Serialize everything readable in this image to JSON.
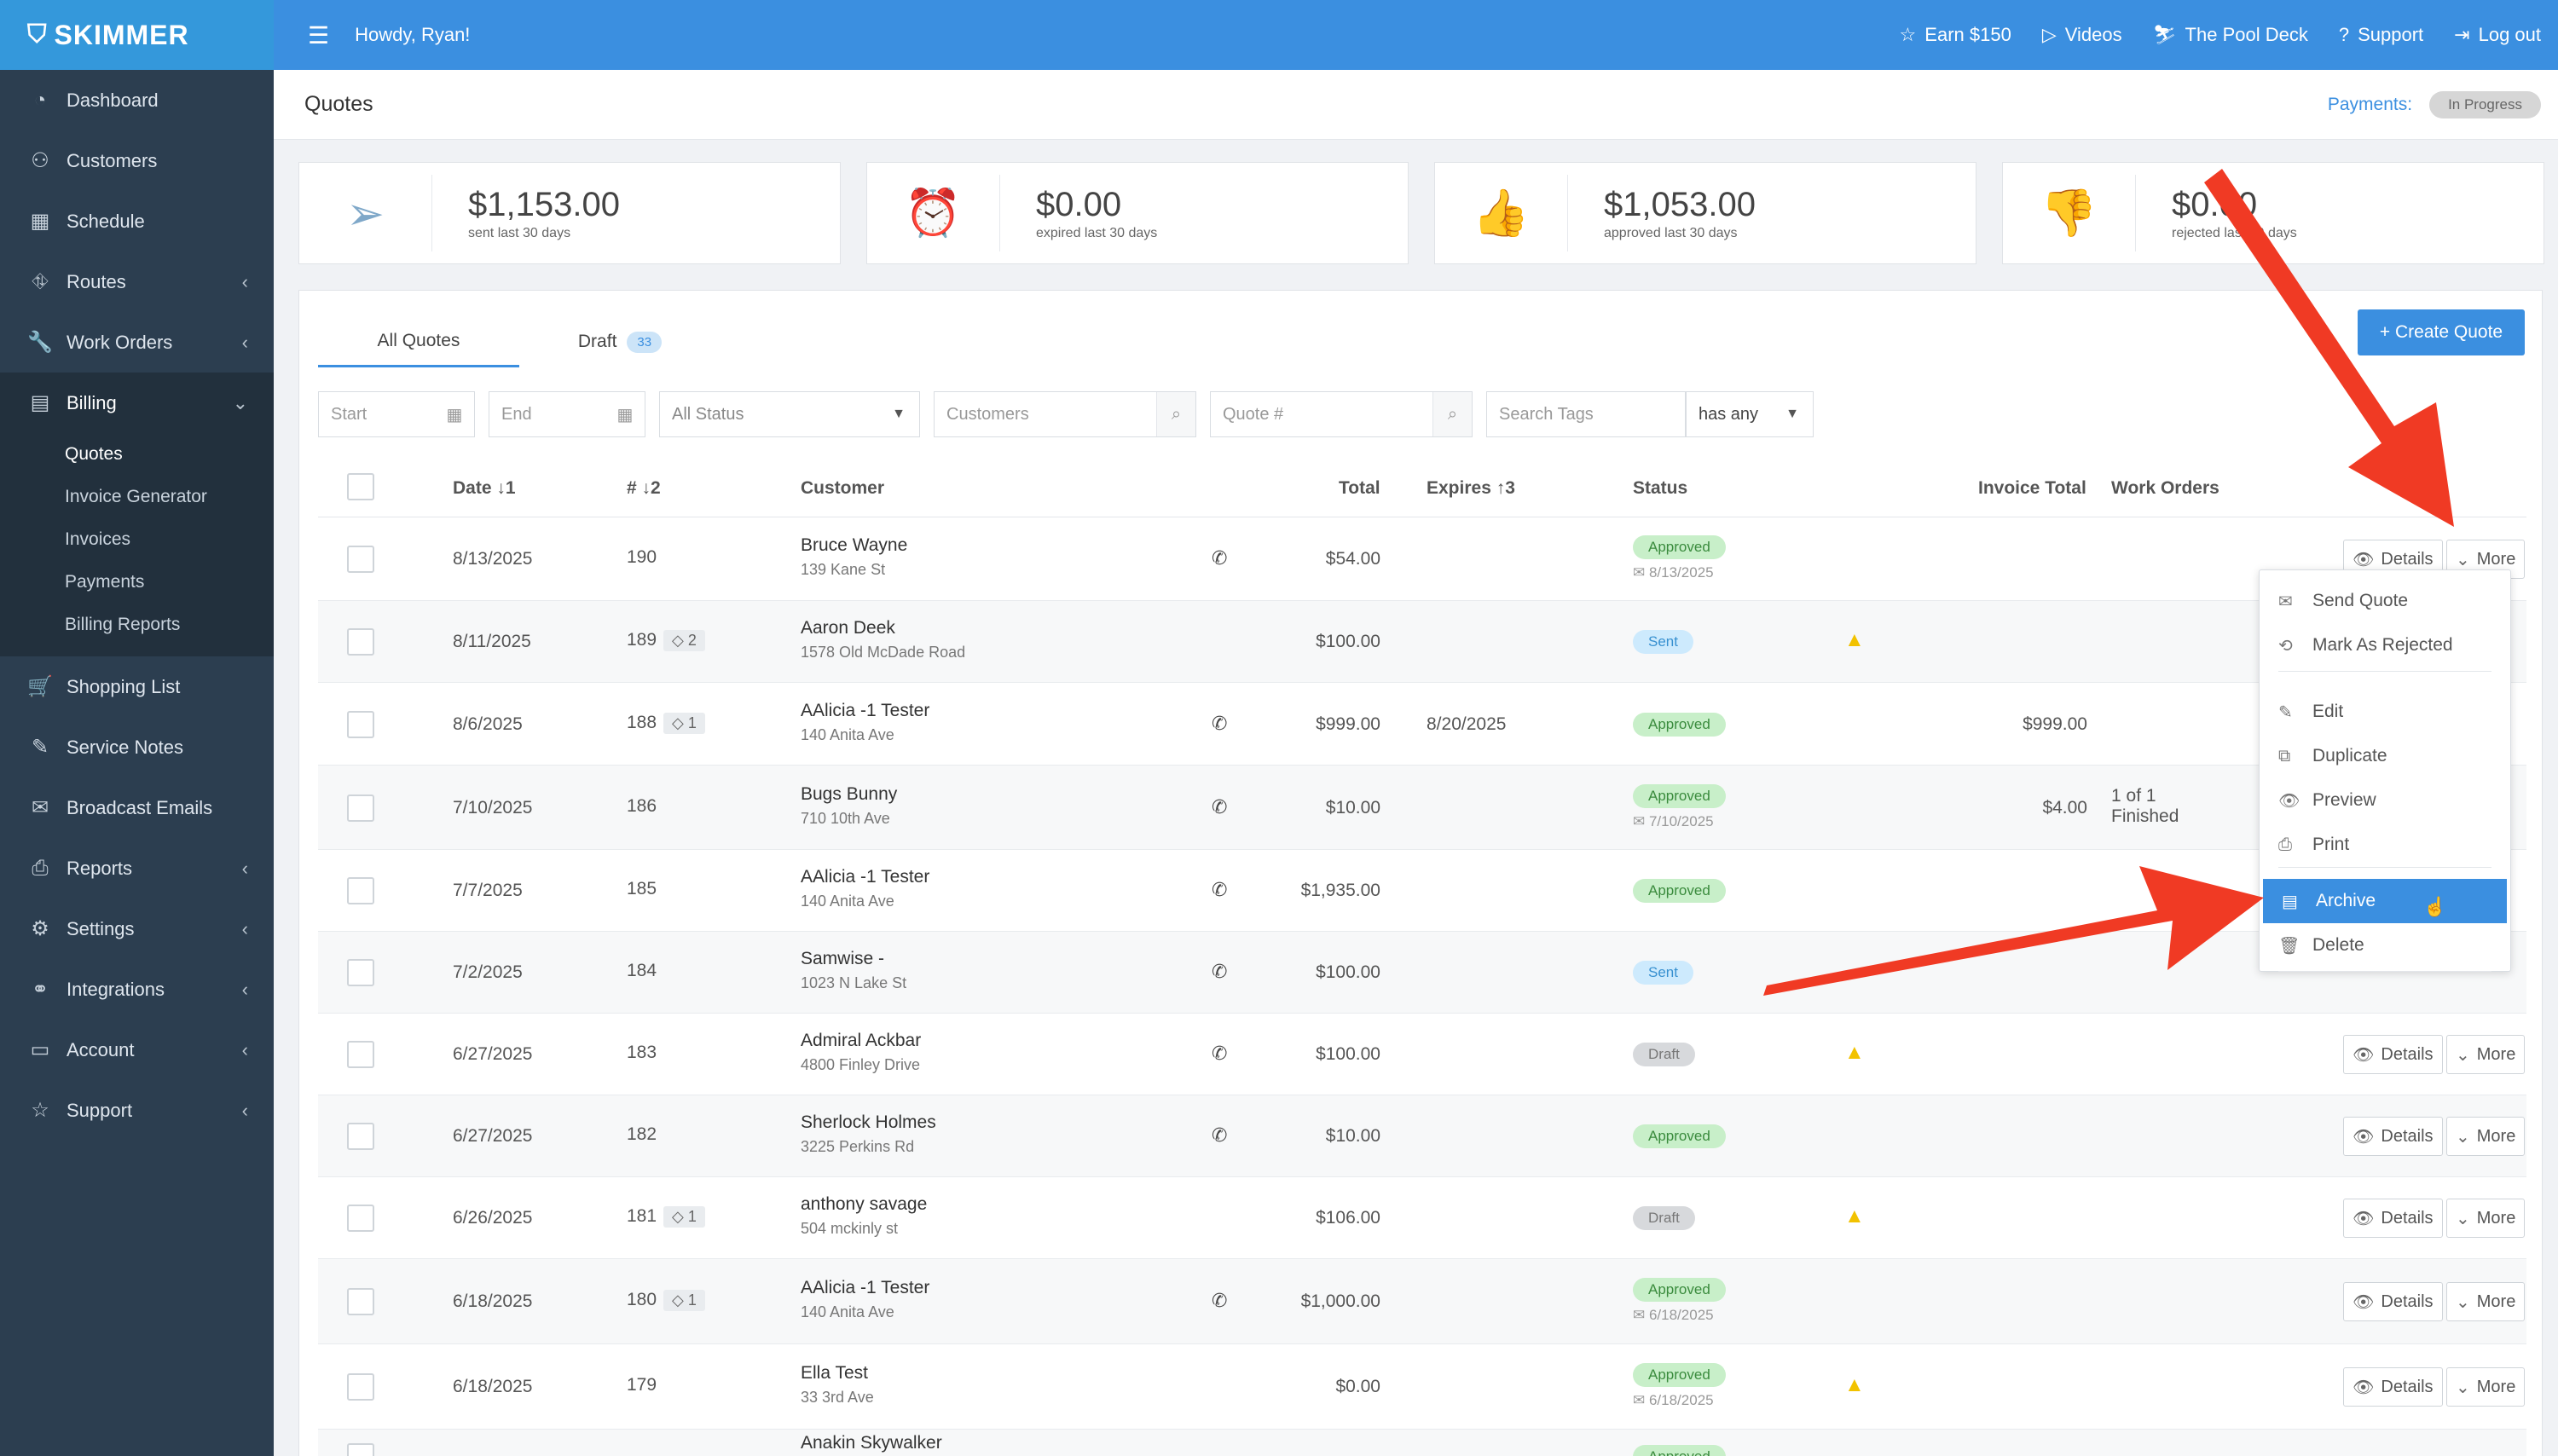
{
  "app": {
    "logo": "SKIMMER"
  },
  "sidebar": {
    "items": [
      {
        "label": "Dashboard",
        "icon": "dashboard-icon"
      },
      {
        "label": "Customers",
        "icon": "customers-icon"
      },
      {
        "label": "Schedule",
        "icon": "calendar-icon"
      },
      {
        "label": "Routes",
        "icon": "routes-icon"
      },
      {
        "label": "Work Orders",
        "icon": "wrench-icon"
      },
      {
        "label": "Billing",
        "icon": "billing-icon"
      }
    ],
    "billing_sub": [
      "Quotes",
      "Invoice Generator",
      "Invoices",
      "Payments",
      "Billing Reports"
    ],
    "items2": [
      {
        "label": "Shopping List",
        "icon": "cart-icon"
      },
      {
        "label": "Service Notes",
        "icon": "note-icon"
      },
      {
        "label": "Broadcast Emails",
        "icon": "mail-icon"
      },
      {
        "label": "Reports",
        "icon": "printer-icon"
      },
      {
        "label": "Settings",
        "icon": "gear-icon"
      },
      {
        "label": "Integrations",
        "icon": "link-icon"
      },
      {
        "label": "Account",
        "icon": "card-icon"
      },
      {
        "label": "Support",
        "icon": "star-icon"
      }
    ]
  },
  "topbar": {
    "greeting": "Howdy, Ryan!",
    "links": [
      "Earn $150",
      "Videos",
      "The Pool Deck",
      "Support",
      "Log out"
    ]
  },
  "header": {
    "title": "Quotes",
    "payments_label": "Payments:",
    "payments_badge": "In Progress"
  },
  "stats": [
    {
      "amount": "$1,153.00",
      "label": "sent last 30 days",
      "icon": "paper-plane-icon",
      "color": "#7fa8c9"
    },
    {
      "amount": "$0.00",
      "label": "expired last 30 days",
      "icon": "alarm-clock-icon",
      "color": "#e58a84"
    },
    {
      "amount": "$1,053.00",
      "label": "approved last 30 days",
      "icon": "thumbs-up-icon",
      "color": "#7dc47f"
    },
    {
      "amount": "$0.00",
      "label": "rejected last 30 days",
      "icon": "thumbs-down-icon",
      "color": "#e58a84"
    }
  ],
  "tabs": {
    "all": "All Quotes",
    "draft": "Draft",
    "draft_count": "33"
  },
  "create_button": "+ Create Quote",
  "filters": {
    "start": "Start",
    "end": "End",
    "status": "All Status",
    "customers": "Customers",
    "quote": "Quote #",
    "tags": "Search Tags",
    "tag_mode": "has any"
  },
  "columns": {
    "date": "Date ↓1",
    "num": "# ↓2",
    "customer": "Customer",
    "total": "Total",
    "expires": "Expires ↑3",
    "status": "Status",
    "invoice_total": "Invoice Total",
    "work_orders": "Work Orders"
  },
  "rows": [
    {
      "date": "8/13/2025",
      "num": "190",
      "tag": "",
      "name": "Bruce Wayne",
      "addr": "139 Kane St",
      "phone": true,
      "total": "$54.00",
      "expires": "",
      "status": "Approved",
      "status_date": "8/13/2025",
      "warn": false,
      "invoice": "",
      "wo1": "",
      "wo2": ""
    },
    {
      "date": "8/11/2025",
      "num": "189",
      "tag": "2",
      "name": "Aaron Deek",
      "addr": "1578 Old McDade Road",
      "phone": false,
      "total": "$100.00",
      "expires": "",
      "status": "Sent",
      "status_date": "",
      "warn": true,
      "invoice": "",
      "wo1": "",
      "wo2": ""
    },
    {
      "date": "8/6/2025",
      "num": "188",
      "tag": "1",
      "name": "AAlicia -1 Tester",
      "addr": "140 Anita Ave",
      "phone": true,
      "total": "$999.00",
      "expires": "8/20/2025",
      "status": "Approved",
      "status_date": "",
      "warn": false,
      "invoice": "$999.00",
      "wo1": "",
      "wo2": ""
    },
    {
      "date": "7/10/2025",
      "num": "186",
      "tag": "",
      "name": "Bugs Bunny",
      "addr": "710 10th Ave",
      "phone": true,
      "total": "$10.00",
      "expires": "",
      "status": "Approved",
      "status_date": "7/10/2025",
      "warn": false,
      "invoice": "$4.00",
      "wo1": "1 of 1",
      "wo2": "Finished"
    },
    {
      "date": "7/7/2025",
      "num": "185",
      "tag": "",
      "name": "AAlicia -1 Tester",
      "addr": "140 Anita Ave",
      "phone": true,
      "total": "$1,935.00",
      "expires": "",
      "status": "Approved",
      "status_date": "",
      "warn": false,
      "invoice": "",
      "wo1": "",
      "wo2": ""
    },
    {
      "date": "7/2/2025",
      "num": "184",
      "tag": "",
      "name": "Samwise -",
      "addr": "1023 N Lake St",
      "phone": true,
      "total": "$100.00",
      "expires": "",
      "status": "Sent",
      "status_date": "",
      "warn": false,
      "invoice": "",
      "wo1": "",
      "wo2": ""
    },
    {
      "date": "6/27/2025",
      "num": "183",
      "tag": "",
      "name": "Admiral Ackbar",
      "addr": "4800 Finley Drive",
      "phone": true,
      "total": "$100.00",
      "expires": "",
      "status": "Draft",
      "status_date": "",
      "warn": true,
      "invoice": "",
      "wo1": "",
      "wo2": ""
    },
    {
      "date": "6/27/2025",
      "num": "182",
      "tag": "",
      "name": "Sherlock Holmes",
      "addr": "3225 Perkins Rd",
      "phone": true,
      "total": "$10.00",
      "expires": "",
      "status": "Approved",
      "status_date": "",
      "warn": false,
      "invoice": "",
      "wo1": "",
      "wo2": ""
    },
    {
      "date": "6/26/2025",
      "num": "181",
      "tag": "1",
      "name": "anthony savage",
      "addr": "504 mckinly st",
      "phone": false,
      "total": "$106.00",
      "expires": "",
      "status": "Draft",
      "status_date": "",
      "warn": true,
      "invoice": "",
      "wo1": "",
      "wo2": ""
    },
    {
      "date": "6/18/2025",
      "num": "180",
      "tag": "1",
      "name": "AAlicia -1 Tester",
      "addr": "140 Anita Ave",
      "phone": true,
      "total": "$1,000.00",
      "expires": "",
      "status": "Approved",
      "status_date": "6/18/2025",
      "warn": false,
      "invoice": "",
      "wo1": "",
      "wo2": ""
    },
    {
      "date": "6/18/2025",
      "num": "179",
      "tag": "",
      "name": "Ella Test",
      "addr": "33 3rd Ave",
      "phone": false,
      "total": "$0.00",
      "expires": "",
      "status": "Approved",
      "status_date": "6/18/2025",
      "warn": true,
      "invoice": "",
      "wo1": "",
      "wo2": ""
    },
    {
      "date": "",
      "num": "",
      "tag": "",
      "name": "Anakin Skywalker",
      "addr": "",
      "phone": false,
      "total": "",
      "expires": "",
      "status": "Approved",
      "status_date": "",
      "warn": false,
      "invoice": "",
      "wo1": "",
      "wo2": ""
    }
  ],
  "row_buttons": {
    "details": "Details",
    "more": "More"
  },
  "more_menu": [
    "Send Quote",
    "Mark As Rejected",
    "Edit",
    "Duplicate",
    "Preview",
    "Print",
    "Archive",
    "Delete"
  ],
  "colors": {
    "primary": "#3b8fe0",
    "sidebar": "#2c3e50",
    "arrow": "#f03a24"
  }
}
